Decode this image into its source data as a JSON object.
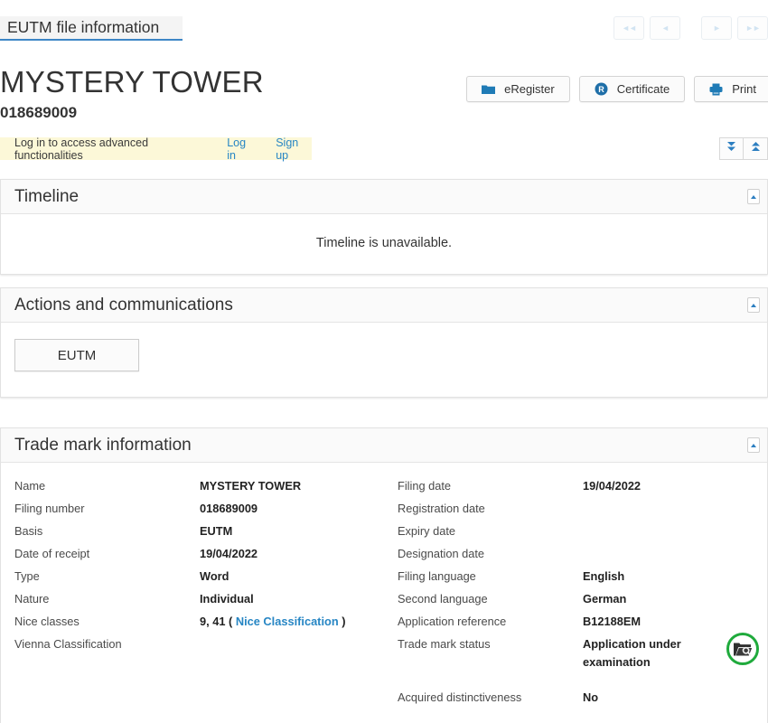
{
  "tab": {
    "label": "EUTM file information"
  },
  "pager": {
    "first": "first-page",
    "prev": "previous-page",
    "next": "next-page",
    "last": "last-page"
  },
  "header": {
    "trademark_name": "MYSTERY TOWER",
    "filing_number": "018689009"
  },
  "action_buttons": [
    {
      "label": "eRegister",
      "icon": "folder-icon"
    },
    {
      "label": "Certificate",
      "icon": "registered-r-icon"
    },
    {
      "label": "Print",
      "icon": "printer-icon"
    }
  ],
  "login_banner": {
    "message": "Log in to access advanced functionalities",
    "login_label": "Log in",
    "signup_label": "Sign up"
  },
  "global_controls": {
    "expand_all": "expand-all",
    "collapse_all": "collapse-all"
  },
  "panels": {
    "timeline": {
      "title": "Timeline",
      "message": "Timeline is unavailable."
    },
    "actions": {
      "title": "Actions and communications",
      "button_label": "EUTM"
    },
    "trademark": {
      "title": "Trade mark information",
      "left_rows": [
        {
          "label": "Name",
          "value": "MYSTERY TOWER"
        },
        {
          "label": "Filing number",
          "value": "018689009"
        },
        {
          "label": "Basis",
          "value": "EUTM"
        },
        {
          "label": "Date of receipt",
          "value": "19/04/2022"
        },
        {
          "label": "Type",
          "value": "Word"
        },
        {
          "label": "Nature",
          "value": "Individual"
        },
        {
          "label": "Nice classes",
          "value": "9, 41 (",
          "link": "Nice Classification",
          "value_suffix": ")"
        },
        {
          "label": "Vienna Classification",
          "value": ""
        }
      ],
      "right_rows": [
        {
          "label": "Filing date",
          "value": "19/04/2022"
        },
        {
          "label": "Registration date",
          "value": ""
        },
        {
          "label": "Expiry date",
          "value": ""
        },
        {
          "label": "Designation date",
          "value": ""
        },
        {
          "label": "Filing language",
          "value": "English"
        },
        {
          "label": "Second language",
          "value": "German"
        },
        {
          "label": "Application reference",
          "value": "B12188EM"
        },
        {
          "label": "Trade mark status",
          "value": "Application under examination"
        },
        {
          "label": "Acquired distinctiveness",
          "value": "No"
        }
      ],
      "status_icon": "folder-search-status-icon"
    }
  },
  "colors": {
    "accent_blue": "#2786c4",
    "tab_underline": "#3d86c6",
    "status_green": "#1faa3c",
    "banner_yellow": "#fcf8d8"
  }
}
